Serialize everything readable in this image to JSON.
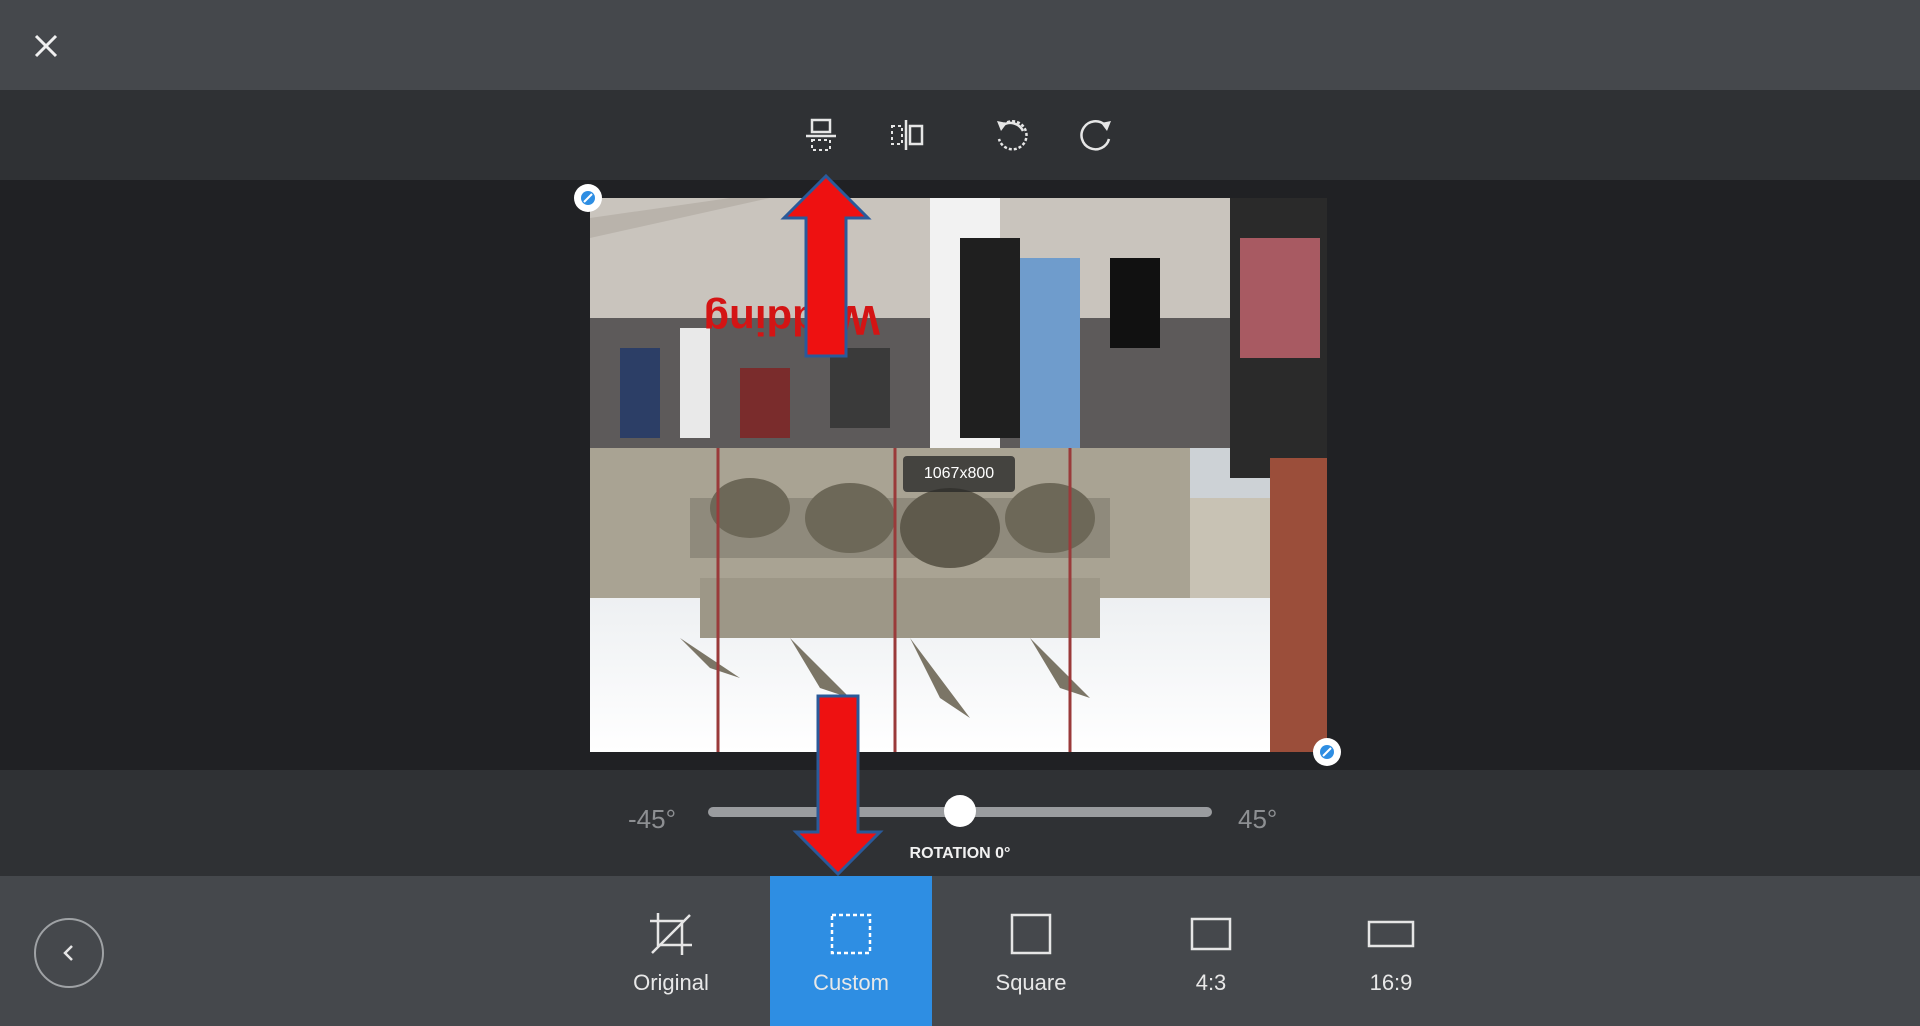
{
  "header": {
    "close_icon": "close-icon"
  },
  "toolbar": {
    "tools": [
      {
        "name": "flip-vertical-button",
        "icon": "flip-vertical-icon"
      },
      {
        "name": "flip-horizontal-button",
        "icon": "flip-horizontal-icon"
      },
      {
        "name": "rotate-left-button",
        "icon": "rotate-ccw-icon"
      },
      {
        "name": "rotate-right-button",
        "icon": "rotate-cw-icon"
      }
    ]
  },
  "canvas": {
    "overlay_text": "Wedding",
    "dimensions": "1067x800"
  },
  "rotation": {
    "min_label": "-45°",
    "max_label": "45°",
    "label": "ROTATION 0°",
    "value": 0
  },
  "aspect_options": [
    {
      "label": "Original",
      "icon": "crop-original-icon",
      "active": false
    },
    {
      "label": "Custom",
      "icon": "crop-custom-icon",
      "active": true
    },
    {
      "label": "Square",
      "icon": "square-icon",
      "active": false
    },
    {
      "label": "4:3",
      "icon": "rect-4-3-icon",
      "active": false
    },
    {
      "label": "16:9",
      "icon": "rect-16-9-icon",
      "active": false
    }
  ],
  "colors": {
    "accent": "#2e8ee3",
    "annotation_arrow": "#ee1111"
  }
}
